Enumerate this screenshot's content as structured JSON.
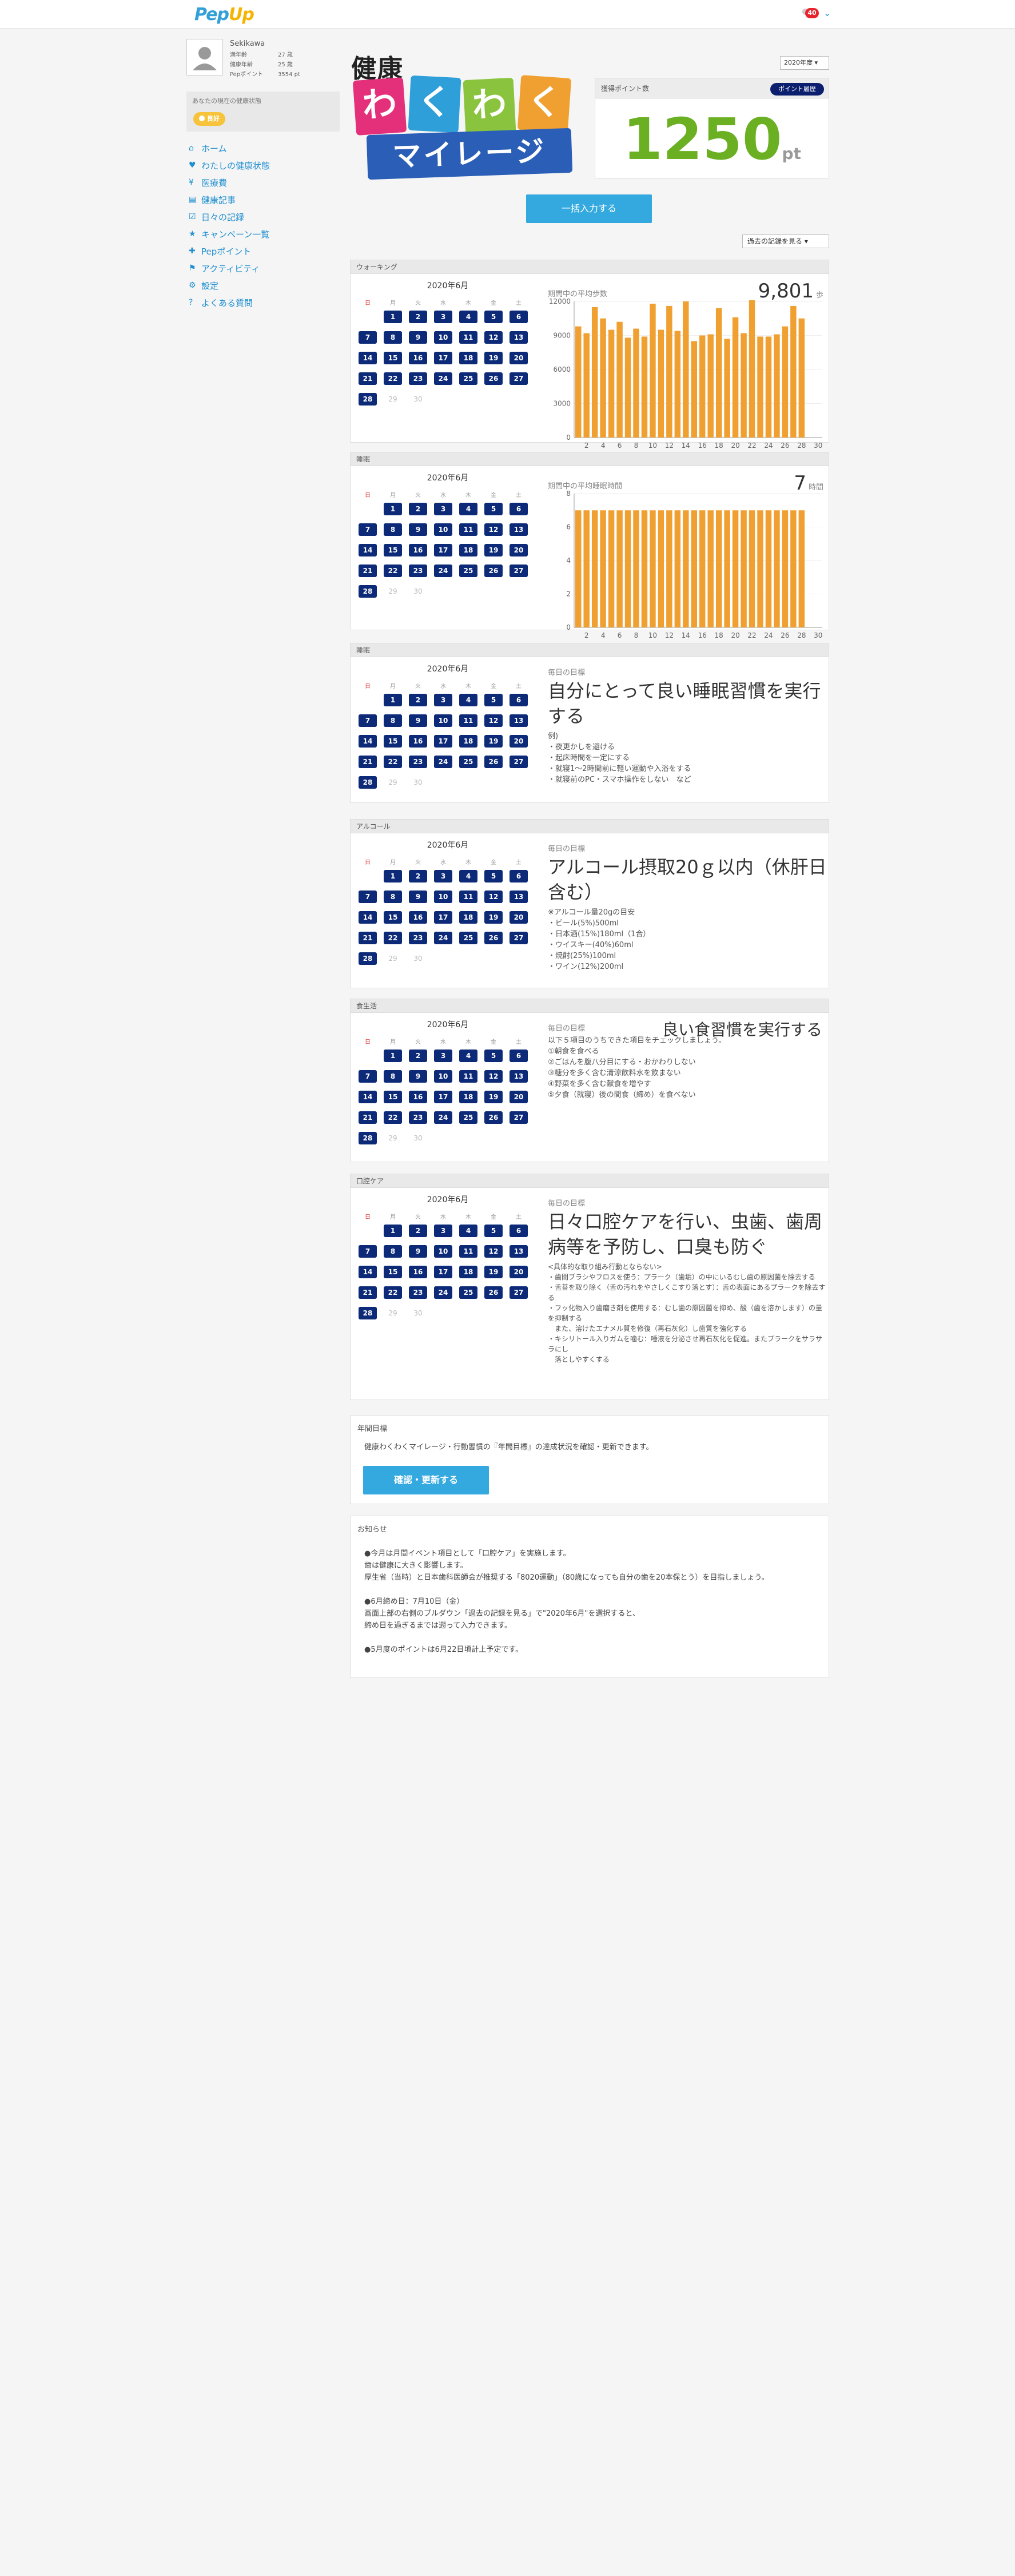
{
  "app": {
    "logo_a": "Pep",
    "logo_b": "Up",
    "notif_count": "40"
  },
  "profile": {
    "name": "Sekikawa",
    "age_label": "満年齢",
    "age_value": "27 歳",
    "health_age_label": "健康年齢",
    "health_age_value": "25 歳",
    "pep_label": "Pepポイント",
    "pep_value": "3554 pt",
    "state_label": "あなたの現在の健康状態",
    "state_badge": "良好"
  },
  "nav": [
    {
      "label": "ホーム",
      "icon": "home-icon"
    },
    {
      "label": "わたしの健康状態",
      "icon": "heart-icon"
    },
    {
      "label": "医療費",
      "icon": "yen-icon"
    },
    {
      "label": "健康記事",
      "icon": "article-icon"
    },
    {
      "label": "日々の記録",
      "icon": "check-icon"
    },
    {
      "label": "キャンペーン一覧",
      "icon": "star-icon"
    },
    {
      "label": "Pepポイント",
      "icon": "gift-icon"
    },
    {
      "label": "アクティビティ",
      "icon": "walk-icon"
    },
    {
      "label": "設定",
      "icon": "gear-icon"
    },
    {
      "label": "よくある質問",
      "icon": "question-icon"
    }
  ],
  "brand": {
    "title": "健康",
    "w1": "わ",
    "w2": "く",
    "w3": "わ",
    "w4": "く",
    "mileage": "マイレージ"
  },
  "year_select": "2020年度 ▾",
  "points": {
    "label": "獲得ポイント数",
    "history": "ポイント履歴",
    "value": "1250",
    "unit": "pt"
  },
  "bulk_button": "一括入力する",
  "past_link": "過去の記録を見る ▾",
  "calendar": {
    "month": "2020年6月",
    "dow": [
      "日",
      "月",
      "火",
      "水",
      "木",
      "金",
      "土"
    ],
    "days": [
      "1",
      "2",
      "3",
      "4",
      "5",
      "6",
      "7",
      "8",
      "9",
      "10",
      "11",
      "12",
      "13",
      "14",
      "15",
      "16",
      "17",
      "18",
      "19",
      "20",
      "21",
      "22",
      "23",
      "24",
      "25",
      "26",
      "27",
      "28",
      "29",
      "30"
    ]
  },
  "sections": {
    "walking": {
      "title": "ウォーキング",
      "chart_label": "期間中の平均歩数",
      "value": "9,801",
      "unit": "歩"
    },
    "sleep_chart": {
      "title": "睡眠",
      "chart_label": "期間中の平均睡眠時間",
      "value": "7",
      "unit": "時間"
    },
    "sleep": {
      "title": "睡眠",
      "goal_label": "毎日の目標",
      "goal": "自分にとって良い睡眠習慣を実行する",
      "text": "例)\n・夜更かしを避ける\n・起床時間を一定にする\n・就寝1〜2時間前に軽い運動や入浴をする\n・就寝前のPC・スマホ操作をしない　など"
    },
    "alcohol": {
      "title": "アルコール",
      "goal_label": "毎日の目標",
      "goal": "アルコール摂取20ｇ以内（休肝日含む）",
      "text": "※アルコール量20gの目安\n・ビール(5%)500ml\n・日本酒(15%)180ml（1合）\n・ウイスキー(40%)60ml\n・焼酎(25%)100ml\n・ワイン(12%)200ml"
    },
    "diet": {
      "title": "食生活",
      "goal_label": "毎日の目標",
      "goal": "良い食習慣を実行する",
      "text": "以下５項目のうちできた項目をチェックしましょう。\n①朝食を食べる\n②ごはんを腹八分目にする・おかわりしない\n③糖分を多く含む清涼飲料水を飲まない\n④野菜を多く含む献食を増やす\n⑤夕食（就寝）後の間食（締め）を食べない"
    },
    "oral": {
      "title": "口腔ケア",
      "goal_label": "毎日の目標",
      "goal": "日々口腔ケアを行い、虫歯、歯周病等を予防し、口臭も防ぐ",
      "text": "<具体的な取り組み行動とならない>\n・歯間ブラシやフロスを使う：プラーク（歯垢）の中にいるむし歯の原因菌を除去する\n・舌苔を取り除く（舌の汚れをやさしくこすり落とす）：舌の表面にあるプラークを除去する\n・フッ化物入り歯磨き剤を使用する：むし歯の原因菌を抑め、酸（歯を溶かします）の量を抑制する\n　また、溶けたエナメル質を修復（再石灰化）し歯質を強化する\n・キシリトール入りガムを噛む：唾液を分泌させ再石灰化を促進。またプラークをサラサラにし\n　落としやすくする"
    }
  },
  "goal_box": {
    "title": "年間目標",
    "text": "健康わくわくマイレージ・行動習慣の『年間目標』の達成状況を確認・更新できます。",
    "button": "確認・更新する"
  },
  "notice": {
    "title": "お知らせ",
    "text": "●今月は月間イベント項目として「口腔ケア」を実施します。\n歯は健康に大きく影響します。\n厚生省（当時）と日本歯科医師会が推奨する「8020運動」（80歳になっても自分の歯を20本保とう）を目指しましょう。\n\n●6月締め日：7月10日（金）\n画面上部の右側のプルダウン「過去の記録を見る」で\"2020年6月\"を選択すると、\n締め日を過ぎるまでは遡って入力できます。\n\n●5月度のポイントは6月22日頃計上予定です。"
  },
  "chart_data": [
    {
      "type": "bar",
      "title": "",
      "x": [
        1,
        2,
        3,
        4,
        5,
        6,
        7,
        8,
        9,
        10,
        11,
        12,
        13,
        14,
        15,
        16,
        17,
        18,
        19,
        20,
        21,
        22,
        23,
        24,
        25,
        26,
        27,
        28,
        29
      ],
      "xticks": [
        "2",
        "4",
        "6",
        "8",
        "10",
        "12",
        "14",
        "16",
        "18",
        "20",
        "22",
        "24",
        "26",
        "28",
        "30"
      ],
      "values": [
        9800,
        9200,
        11500,
        10500,
        9500,
        10200,
        8800,
        9600,
        8900,
        11800,
        9500,
        11600,
        9400,
        12000,
        8500,
        9000,
        9100,
        11400,
        8700,
        10600,
        9200,
        12100,
        8900,
        8900,
        9100,
        9800,
        11600,
        10500,
        0
      ],
      "ylim": [
        0,
        12000
      ],
      "yticks": [
        "0",
        "3000",
        "6000",
        "9000",
        "12000"
      ],
      "color": "#f0a030"
    },
    {
      "type": "bar",
      "title": "",
      "x": [
        1,
        2,
        3,
        4,
        5,
        6,
        7,
        8,
        9,
        10,
        11,
        12,
        13,
        14,
        15,
        16,
        17,
        18,
        19,
        20,
        21,
        22,
        23,
        24,
        25,
        26,
        27,
        28,
        29
      ],
      "xticks": [
        "2",
        "4",
        "6",
        "8",
        "10",
        "12",
        "14",
        "16",
        "18",
        "20",
        "22",
        "24",
        "26",
        "28",
        "30"
      ],
      "values": [
        7,
        7,
        7,
        7,
        7,
        7,
        7,
        7,
        7,
        7,
        7,
        7,
        7,
        7,
        7,
        7,
        7,
        7,
        7,
        7,
        7,
        7,
        7,
        7,
        7,
        7,
        7,
        7,
        0
      ],
      "ylim": [
        0,
        8
      ],
      "yticks": [
        "0",
        "2",
        "4",
        "6",
        "8"
      ],
      "color": "#f0a030"
    }
  ]
}
